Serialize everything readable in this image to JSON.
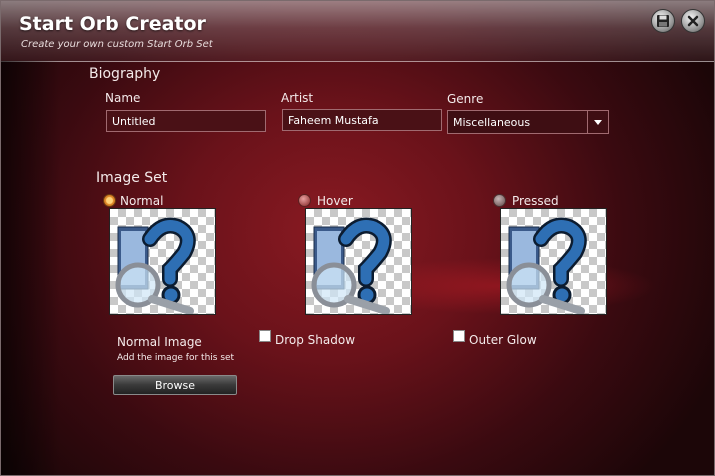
{
  "window": {
    "title": "Start Orb Creator",
    "subtitle": "Create your own custom Start Orb Set"
  },
  "titlebar_buttons": {
    "save_icon": "floppy-disk-icon",
    "close_icon": "close-icon"
  },
  "biography": {
    "heading": "Biography",
    "name_label": "Name",
    "name_value": "Untitled",
    "artist_label": "Artist",
    "artist_value": "Faheem Mustafa",
    "genre_label": "Genre",
    "genre_value": "Miscellaneous"
  },
  "image_set": {
    "heading": "Image Set",
    "states": [
      {
        "label": "Normal",
        "selected": true
      },
      {
        "label": "Hover",
        "selected": false
      },
      {
        "label": "Pressed",
        "selected": false
      }
    ],
    "normal_image_label": "Normal Image",
    "normal_image_hint": "Add the image for this set",
    "browse_label": "Browse",
    "drop_shadow_label": "Drop Shadow",
    "outer_glow_label": "Outer Glow"
  },
  "colors": {
    "accent_red": "#8a1a22",
    "field_bg": "#4a1116"
  }
}
